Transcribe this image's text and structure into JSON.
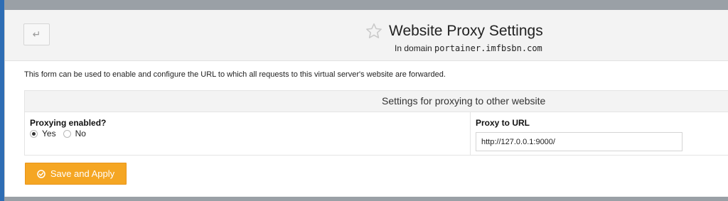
{
  "header": {
    "back_icon": "back-arrow-icon",
    "star_icon": "star-outline-icon",
    "title": "Website Proxy Settings",
    "subtitle_prefix": "In domain",
    "domain": "portainer.imfbsbn.com"
  },
  "description": "This form can be used to enable and configure the URL to which all requests to this virtual server's website are forwarded.",
  "settings": {
    "section_title": "Settings for proxying to other website",
    "proxying_enabled": {
      "label": "Proxying enabled?",
      "options": [
        "Yes",
        "No"
      ],
      "selected": "Yes"
    },
    "proxy_url": {
      "label": "Proxy to URL",
      "value": "http://127.0.0.1:9000/"
    }
  },
  "actions": {
    "save_label": "Save and Apply",
    "save_icon": "check-circle-icon"
  },
  "colors": {
    "accent": "#f5a623",
    "header_bg": "#f3f3f3",
    "page_bg": "#9aa0a6",
    "left_edge": "#2e6db4"
  }
}
